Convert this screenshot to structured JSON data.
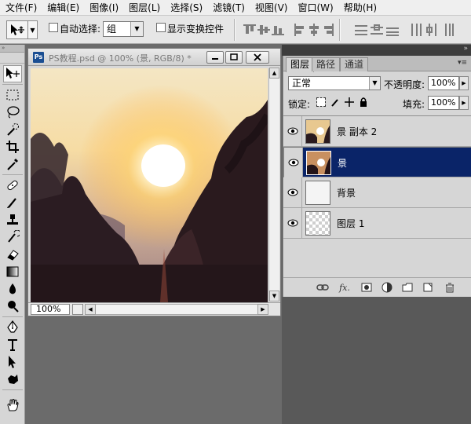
{
  "menu": [
    "文件(F)",
    "编辑(E)",
    "图像(I)",
    "图层(L)",
    "选择(S)",
    "滤镜(T)",
    "视图(V)",
    "窗口(W)",
    "帮助(H)"
  ],
  "options": {
    "auto_select_label": "自动选择:",
    "auto_select_value": "组",
    "show_transform_label": "显示变换控件"
  },
  "toolbox": {
    "tools": [
      "move-tool-icon",
      "marquee-tool-icon",
      "lasso-tool-icon",
      "quick-select-tool-icon",
      "crop-tool-icon",
      "eyedropper-tool-icon",
      "healing-brush-tool-icon",
      "brush-tool-icon",
      "clone-stamp-tool-icon",
      "history-brush-tool-icon",
      "eraser-tool-icon",
      "gradient-tool-icon",
      "blur-tool-icon",
      "dodge-tool-icon",
      "pen-tool-icon",
      "type-tool-icon",
      "path-select-tool-icon",
      "shape-tool-icon",
      "hand-tool-icon"
    ]
  },
  "document": {
    "title": "PS教程.psd @ 100% (景, RGB/8) *",
    "zoom": "100%"
  },
  "layers_panel": {
    "tabs": [
      "图层",
      "路径",
      "通道"
    ],
    "blend_mode": "正常",
    "opacity_label": "不透明度:",
    "opacity_value": "100%",
    "lock_label": "锁定:",
    "fill_label": "填充:",
    "fill_value": "100%",
    "layers": [
      {
        "name": "景 副本 2",
        "thumb": "sunset",
        "selected": false
      },
      {
        "name": "景",
        "thumb": "sunset",
        "selected": true
      },
      {
        "name": "背景",
        "thumb": "blank",
        "selected": false
      },
      {
        "name": "图层 1",
        "thumb": "transparent",
        "selected": false
      }
    ]
  },
  "colors": {
    "selection": "#0a2468",
    "workspace": "#6b6b6b"
  }
}
